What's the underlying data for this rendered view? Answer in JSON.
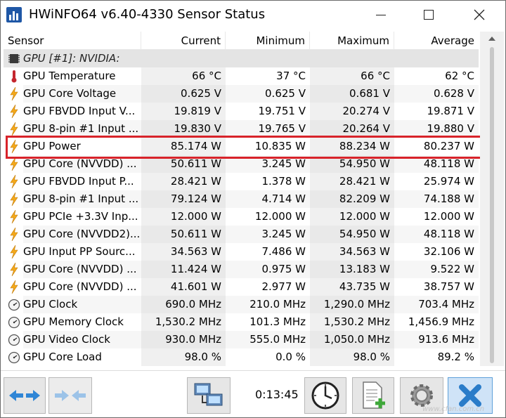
{
  "window": {
    "title": "HWiNFO64 v6.40-4330 Sensor Status",
    "icon": "hwinfo-app-icon"
  },
  "table": {
    "columns": [
      "Sensor",
      "Current",
      "Minimum",
      "Maximum",
      "Average"
    ],
    "group_label": "GPU [#1]: NVIDIA:",
    "rows": [
      {
        "icon": "thermometer-icon",
        "label": "GPU Temperature",
        "current": "66 °C",
        "minimum": "37 °C",
        "maximum": "66 °C",
        "average": "62 °C"
      },
      {
        "icon": "lightning-icon",
        "label": "GPU Core Voltage",
        "current": "0.625 V",
        "minimum": "0.625 V",
        "maximum": "0.681 V",
        "average": "0.628 V"
      },
      {
        "icon": "lightning-icon",
        "label": "GPU FBVDD Input V...",
        "current": "19.819 V",
        "minimum": "19.751 V",
        "maximum": "20.274 V",
        "average": "19.871 V"
      },
      {
        "icon": "lightning-icon",
        "label": "GPU 8-pin #1 Input ...",
        "current": "19.830 V",
        "minimum": "19.765 V",
        "maximum": "20.264 V",
        "average": "19.880 V"
      },
      {
        "icon": "lightning-icon",
        "label": "GPU Power",
        "current": "85.174 W",
        "minimum": "10.835 W",
        "maximum": "88.234 W",
        "average": "80.237 W"
      },
      {
        "icon": "lightning-icon",
        "label": "GPU Core (NVVDD) ...",
        "current": "50.611 W",
        "minimum": "3.245 W",
        "maximum": "54.950 W",
        "average": "48.118 W"
      },
      {
        "icon": "lightning-icon",
        "label": "GPU FBVDD Input P...",
        "current": "28.421 W",
        "minimum": "1.378 W",
        "maximum": "28.421 W",
        "average": "25.974 W"
      },
      {
        "icon": "lightning-icon",
        "label": "GPU 8-pin #1 Input ...",
        "current": "79.124 W",
        "minimum": "4.714 W",
        "maximum": "82.209 W",
        "average": "74.188 W"
      },
      {
        "icon": "lightning-icon",
        "label": "GPU PCIe +3.3V Inp...",
        "current": "12.000 W",
        "minimum": "12.000 W",
        "maximum": "12.000 W",
        "average": "12.000 W"
      },
      {
        "icon": "lightning-icon",
        "label": "GPU Core (NVVDD2)...",
        "current": "50.611 W",
        "minimum": "3.245 W",
        "maximum": "54.950 W",
        "average": "48.118 W"
      },
      {
        "icon": "lightning-icon",
        "label": "GPU Input PP Sourc...",
        "current": "34.563 W",
        "minimum": "7.486 W",
        "maximum": "34.563 W",
        "average": "32.106 W"
      },
      {
        "icon": "lightning-icon",
        "label": "GPU Core (NVVDD) ...",
        "current": "11.424 W",
        "minimum": "0.975 W",
        "maximum": "13.183 W",
        "average": "9.522 W"
      },
      {
        "icon": "lightning-icon",
        "label": "GPU Core (NVVDD) ...",
        "current": "41.601 W",
        "minimum": "2.977 W",
        "maximum": "43.735 W",
        "average": "38.757 W"
      },
      {
        "icon": "clock-gauge-icon",
        "label": "GPU Clock",
        "current": "690.0 MHz",
        "minimum": "210.0 MHz",
        "maximum": "1,290.0 MHz",
        "average": "703.4 MHz"
      },
      {
        "icon": "clock-gauge-icon",
        "label": "GPU Memory Clock",
        "current": "1,530.2 MHz",
        "minimum": "101.3 MHz",
        "maximum": "1,530.2 MHz",
        "average": "1,456.9 MHz"
      },
      {
        "icon": "clock-gauge-icon",
        "label": "GPU Video Clock",
        "current": "930.0 MHz",
        "minimum": "555.0 MHz",
        "maximum": "1,050.0 MHz",
        "average": "913.6 MHz"
      },
      {
        "icon": "clock-gauge-icon",
        "label": "GPU Core Load",
        "current": "98.0 %",
        "minimum": "0.0 %",
        "maximum": "98.0 %",
        "average": "89.2 %"
      }
    ]
  },
  "toolbar": {
    "timer": "0:13:45"
  },
  "watermark": "www.cfan.com.cn",
  "colors": {
    "highlight": "#d8232a",
    "lightning": "#f3a81b",
    "thermometer": "#c4262e",
    "accent": "#1f57a6"
  }
}
